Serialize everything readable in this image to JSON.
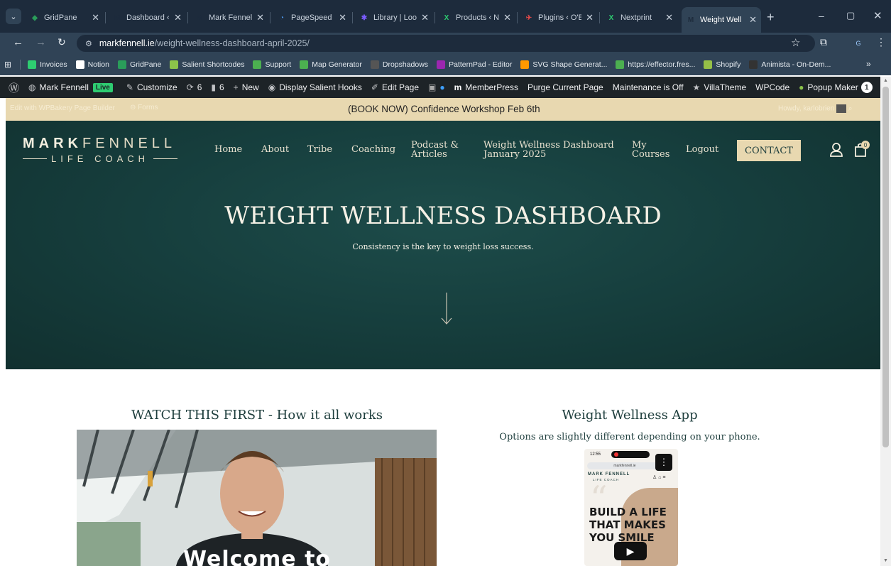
{
  "browser": {
    "tabs": [
      {
        "title": "GridPane",
        "color": "#2a9d5a",
        "glyph": "◆"
      },
      {
        "title": "Dashboard ‹",
        "color": "#1d2b3c",
        "glyph": "M"
      },
      {
        "title": "Mark Fennell",
        "color": "#1d2b3c",
        "glyph": "M"
      },
      {
        "title": "PageSpeed I",
        "color": "#4a90e2",
        "glyph": "◔"
      },
      {
        "title": "Library | Loo",
        "color": "#7b5cff",
        "glyph": "✱"
      },
      {
        "title": "Products ‹ N",
        "color": "#2ecc71",
        "glyph": "X"
      },
      {
        "title": "Plugins ‹ O'E",
        "color": "#e24a4a",
        "glyph": "✈"
      },
      {
        "title": "Nextprint",
        "color": "#2ecc71",
        "glyph": "X"
      },
      {
        "title": "Weight Well",
        "color": "#1d2b3c",
        "glyph": "M"
      }
    ],
    "url_domain": "markfennell.ie",
    "url_path": "/weight-wellness-dashboard-april-2025/",
    "profile_initial": "G",
    "bookmarks": [
      {
        "label": "Invoices",
        "color": "#2ecc71"
      },
      {
        "label": "Notion",
        "color": "#ffffff"
      },
      {
        "label": "GridPane",
        "color": "#2a9d5a"
      },
      {
        "label": "Salient Shortcodes",
        "color": "#8bc34a"
      },
      {
        "label": "Support",
        "color": "#4caf50"
      },
      {
        "label": "Map Generator",
        "color": "#4caf50"
      },
      {
        "label": "Dropshadows",
        "color": "#555"
      },
      {
        "label": "PatternPad - Editor",
        "color": "#9c27b0"
      },
      {
        "label": "SVG Shape Generat...",
        "color": "#ff9800"
      },
      {
        "label": "https://effector.fres...",
        "color": "#4caf50"
      },
      {
        "label": "Shopify",
        "color": "#95bf47"
      },
      {
        "label": "Animista - On-Dem...",
        "color": "#333"
      }
    ]
  },
  "adminbar": {
    "site": "Mark Fennell",
    "live": "Live",
    "customize": "Customize",
    "updates": "6",
    "comments": "6",
    "new": "New",
    "display_hooks": "Display Salient Hooks",
    "edit_page": "Edit Page",
    "memberpress": "MemberPress",
    "purge": "Purge Current Page",
    "maintenance": "Maintenance is Off",
    "villatheme": "VillaTheme",
    "wpcode": "WPCode",
    "popup": "Popup Maker",
    "popup_count": "1"
  },
  "announcement": {
    "left1": "Edit with WPBakery Page Builder",
    "left2": "Forms",
    "text": "(BOOK NOW) Confidence Workshop Feb 6th",
    "howdy": "Howdy, karlobrien"
  },
  "site": {
    "logo_mark": "MARK",
    "logo_fennell": "FENNELL",
    "logo_sub": "LIFE COACH",
    "nav": [
      {
        "label": "Home"
      },
      {
        "label": "About"
      },
      {
        "label": "Tribe"
      },
      {
        "label": "Coaching"
      },
      {
        "label": "Podcast &\nArticles"
      },
      {
        "label": "Weight Wellness Dashboard\nJanuary 2025"
      },
      {
        "label": "My\nCourses"
      },
      {
        "label": "Logout"
      }
    ],
    "contact": "CONTACT",
    "cart_count": "0",
    "hero_title": "WEIGHT WELLNESS DASHBOARD",
    "hero_subtitle": "Consistency is the key to weight loss success."
  },
  "content": {
    "left_heading": "WATCH THIS FIRST - How it all works",
    "video_overlay": "Welcome to",
    "right_heading": "Weight Wellness App",
    "right_sub": "Options are slightly different depending on your phone.",
    "phone_time": "12:55",
    "phone_url": "markfennell.ie",
    "phone_logo": "MARK FENNELL",
    "phone_logo_sub": "LIFE COACH",
    "phone_text": "BUILD A LIFE THAT MAKES YOU SMILE"
  }
}
